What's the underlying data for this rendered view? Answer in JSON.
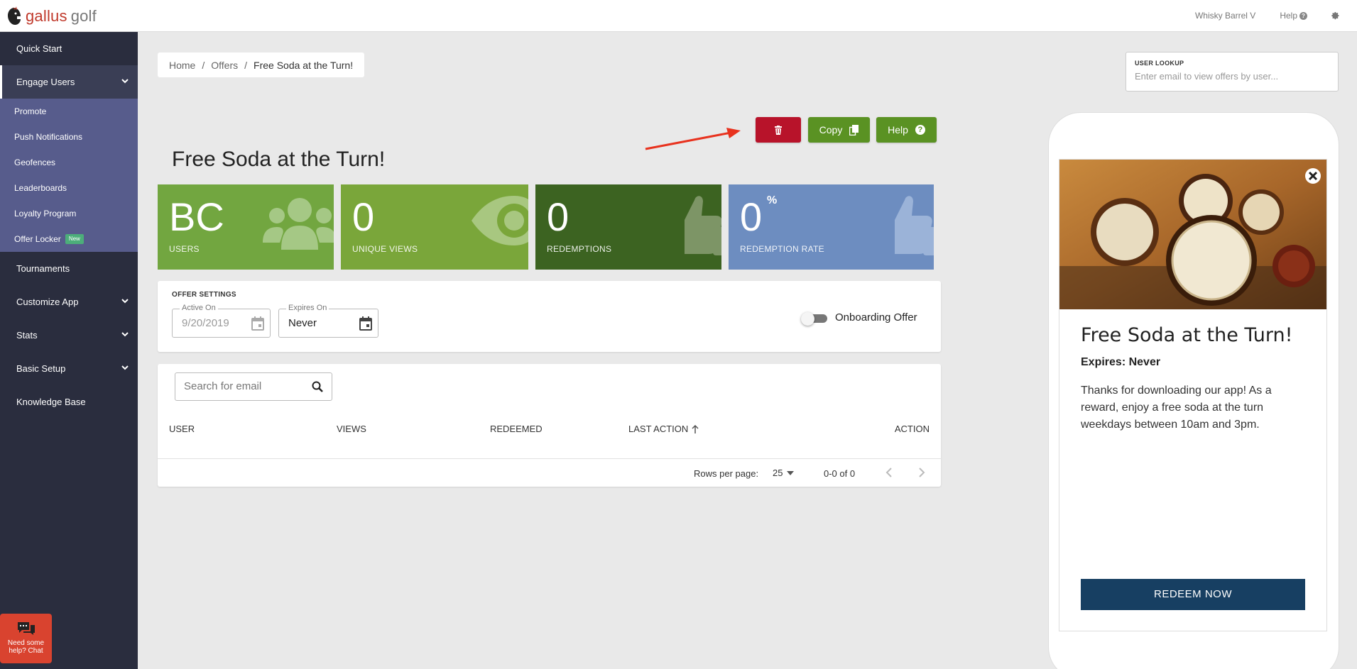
{
  "topbar": {
    "logo_left": "gallus",
    "logo_right": "golf",
    "account": "Whisky Barrel V",
    "help": "Help"
  },
  "sidebar": {
    "quick_start": "Quick Start",
    "engage_users": "Engage Users",
    "sub": [
      "Promote",
      "Push Notifications",
      "Geofences",
      "Leaderboards",
      "Loyalty Program",
      "Offer Locker"
    ],
    "new_badge": "New",
    "tournaments": "Tournaments",
    "customize_app": "Customize App",
    "stats": "Stats",
    "basic_setup": "Basic Setup",
    "knowledge_base": "Knowledge Base",
    "chat": "Need some help? Chat"
  },
  "breadcrumb": {
    "home": "Home",
    "offers": "Offers",
    "current": "Free Soda at the Turn!",
    "sep": "/"
  },
  "lookup": {
    "label": "USER LOOKUP",
    "placeholder": "Enter email to view offers by user..."
  },
  "actions": {
    "copy": "Copy",
    "help": "Help"
  },
  "page_title": "Free Soda at the Turn!",
  "stats": [
    {
      "value": "BC",
      "label": "USERS"
    },
    {
      "value": "0",
      "label": "UNIQUE VIEWS"
    },
    {
      "value": "0",
      "label": "REDEMPTIONS"
    },
    {
      "value": "0",
      "label": "REDEMPTION RATE",
      "suffix": "%"
    }
  ],
  "settings": {
    "title": "OFFER SETTINGS",
    "active_label": "Active On",
    "active_value": "9/20/2019",
    "expires_label": "Expires On",
    "expires_value": "Never",
    "onboarding": "Onboarding Offer"
  },
  "table": {
    "search_placeholder": "Search for email",
    "columns": [
      "USER",
      "VIEWS",
      "REDEEMED",
      "LAST ACTION",
      "ACTION"
    ],
    "rows_per_page_label": "Rows per page:",
    "rows_per_page": "25",
    "range": "0-0 of 0"
  },
  "preview": {
    "title": "Free Soda at the Turn!",
    "expires": "Expires: Never",
    "description": "Thanks for downloading our app! As a reward, enjoy a free soda at the turn weekdays between 10am and 3pm.",
    "redeem": "REDEEM NOW"
  },
  "colors": {
    "delete": "#b8132a",
    "green": "#5a9223",
    "sidebar": "#2a2d3e",
    "submenu": "#575c8c",
    "redeem": "#173f62"
  }
}
